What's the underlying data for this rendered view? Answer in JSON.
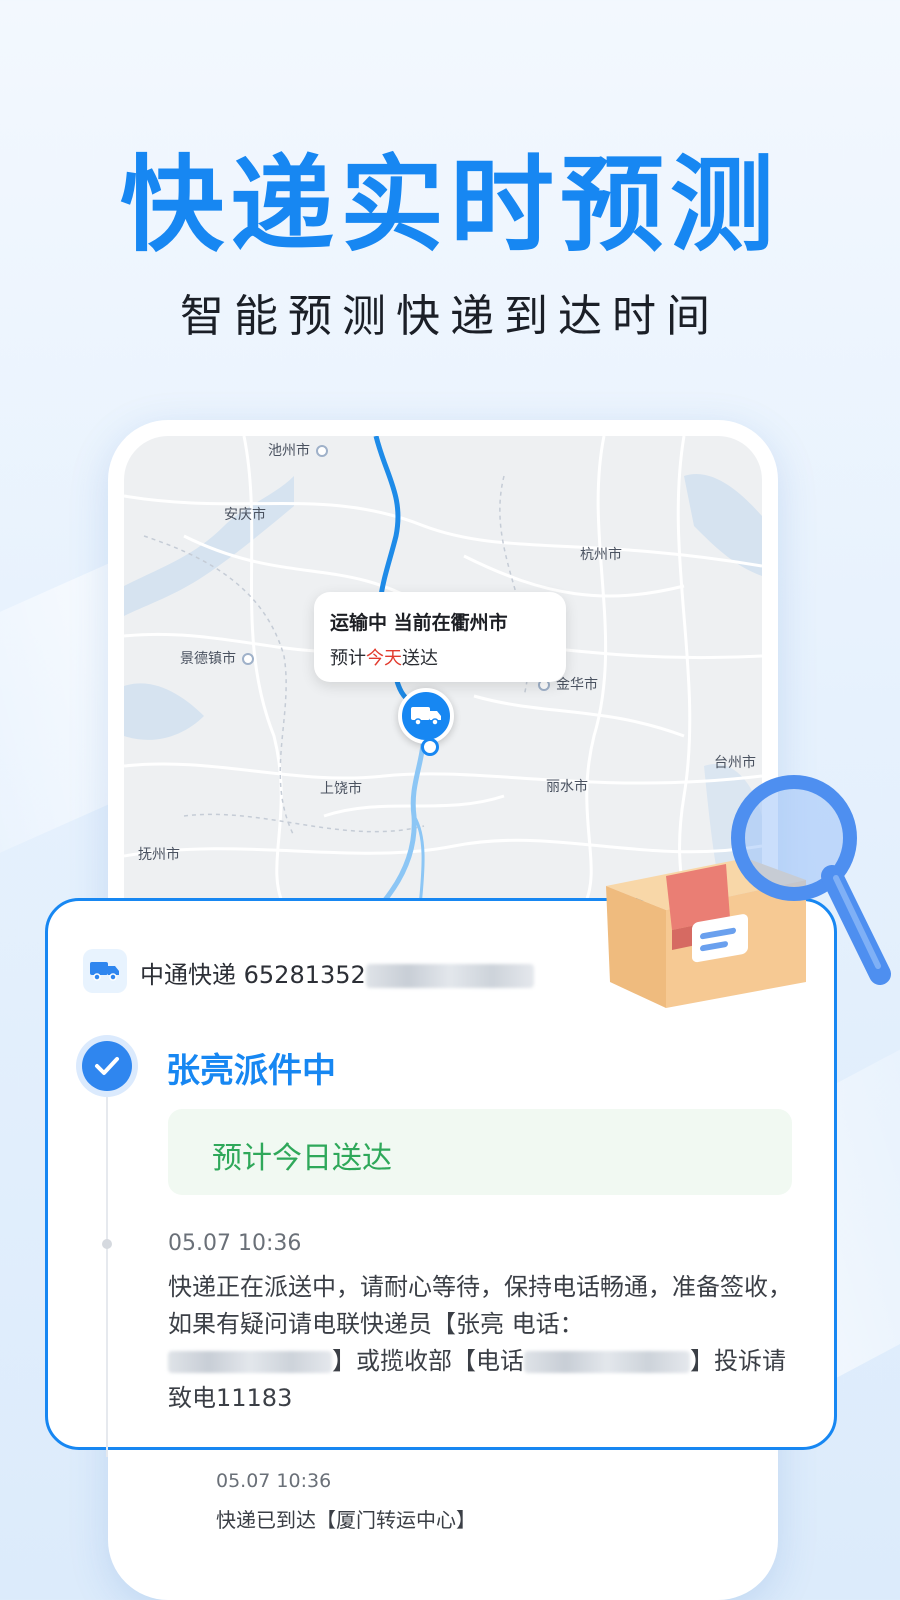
{
  "hero": {
    "title": "快递实时预测",
    "subtitle": "智能预测快递到达时间"
  },
  "map": {
    "cities": [
      {
        "name": "池州市"
      },
      {
        "name": "安庆市"
      },
      {
        "name": "杭州市"
      },
      {
        "name": "景德镇市"
      },
      {
        "name": "金华市"
      },
      {
        "name": "台州市"
      },
      {
        "name": "上饶市"
      },
      {
        "name": "丽水市"
      },
      {
        "name": "抚州市"
      }
    ],
    "status_bubble": {
      "line1": "运输中 当前在衢州市",
      "line2_prefix": "预计",
      "line2_highlight": "今天",
      "line2_suffix": "送达"
    }
  },
  "tracking": {
    "carrier": "中通快递",
    "tracking_number_visible": "65281352",
    "status_title": "张亮派件中",
    "eta": "预计今日送达",
    "events": [
      {
        "time": "05.07 10:36",
        "desc_part1": "快递正在派送中，请耐心等待，保持电话畅通，准备签收，如果有疑问请电联快递员【张亮 电话：",
        "desc_part2": "】或揽收部【电话",
        "desc_part3": "】投诉请致电11183"
      },
      {
        "time": "05.07 10:36",
        "desc": "快递已到达【厦门转运中心】"
      }
    ]
  },
  "colors": {
    "brand_blue": "#1787f2",
    "eta_green": "#2fa85a",
    "highlight_red": "#e23b2e",
    "route_blue": "#2a8ee8"
  },
  "icons": [
    "truck-icon",
    "check-icon",
    "package-box-icon",
    "magnifier-icon",
    "location-pin-icon"
  ]
}
